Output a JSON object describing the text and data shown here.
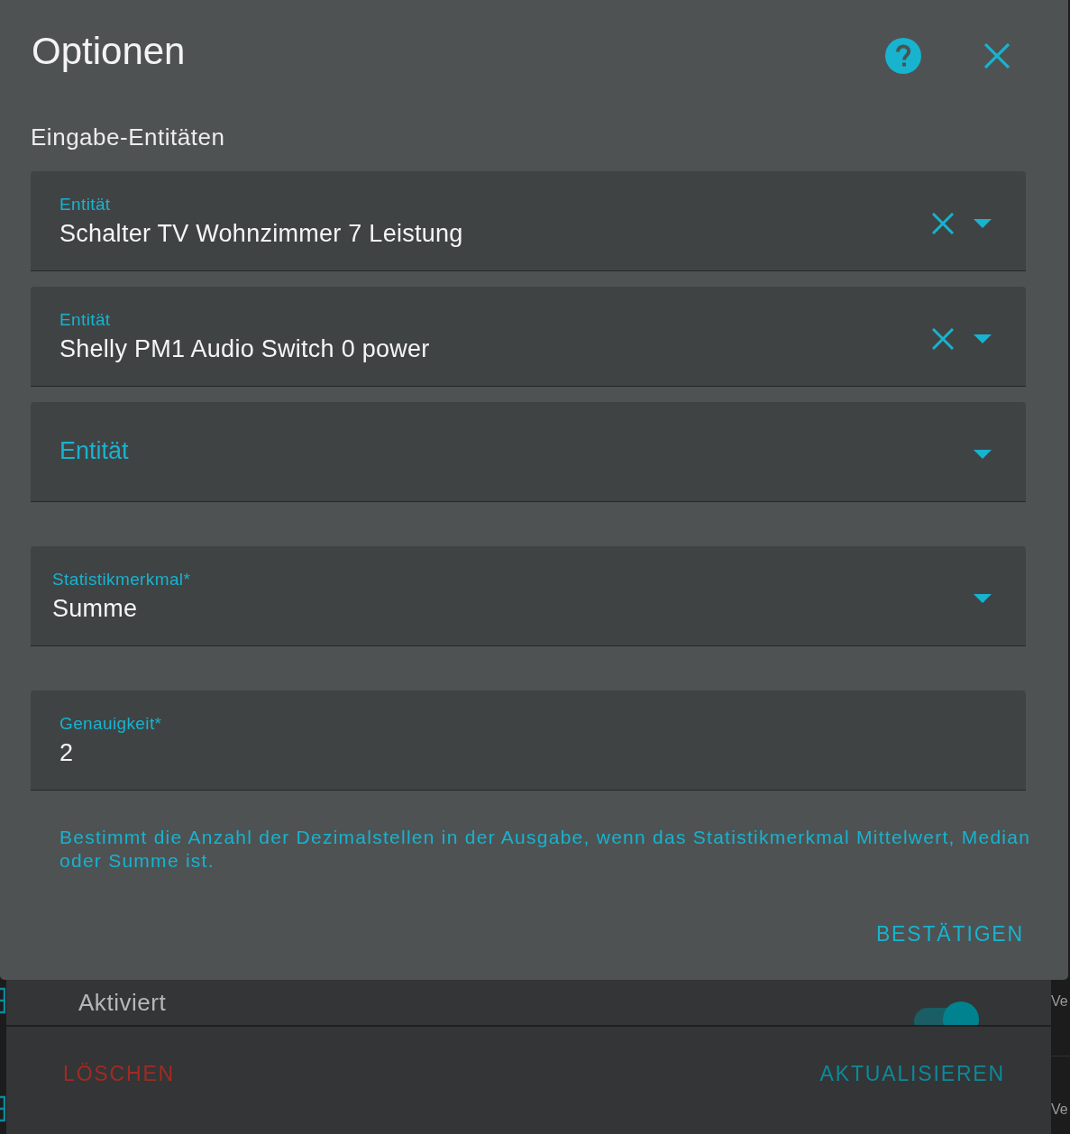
{
  "dialog": {
    "title": "Optionen",
    "section_title": "Eingabe-Entitäten",
    "fields": [
      {
        "kind": "entity",
        "label": "Entität",
        "value": "Schalter TV Wohnzimmer 7 Leistung",
        "clearable": true
      },
      {
        "kind": "entity",
        "label": "Entität",
        "value": "Shelly PM1 Audio Switch 0 power",
        "clearable": true
      },
      {
        "kind": "entity",
        "label": "Entität",
        "clearable": false
      },
      {
        "kind": "select",
        "label": "Statistikmerkmal*",
        "value": "Summe"
      },
      {
        "kind": "number",
        "label": "Genauigkeit*",
        "value": "2",
        "helper": "Bestimmt die Anzahl der Dezimalstellen in der Ausgabe, wenn das Statistikmerkmal Mittelwert, Median oder Summe ist."
      }
    ],
    "confirm_button": "BESTÄTIGEN"
  },
  "background_dialog": {
    "toggle_row": {
      "label": "Aktiviert",
      "on": true
    },
    "buttons": [
      {
        "kind": "danger",
        "label": "LÖSCHEN"
      },
      {
        "kind": "primary",
        "label": "AKTUALISIEREN"
      }
    ]
  },
  "page": {
    "edge_texts": [
      "Ve",
      "Ve"
    ]
  }
}
